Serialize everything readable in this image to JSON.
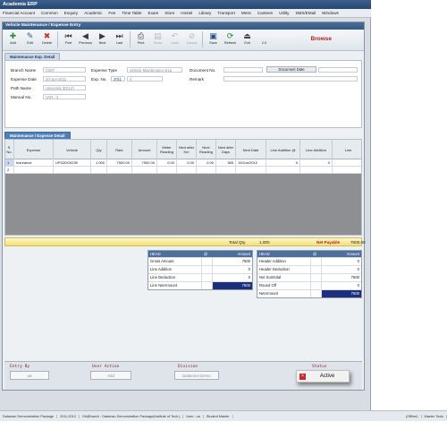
{
  "app": {
    "title": "Academia ERP"
  },
  "menu": [
    "Financial Account",
    "Common",
    "Enquiry",
    "Academic",
    "Fee",
    "Time Table",
    "Exam",
    "Store",
    "Hostel",
    "Library",
    "Transport",
    "Mess",
    "Canteen",
    "Utility",
    "SMS/EMail",
    "Windows"
  ],
  "window": {
    "title": "Vehicle Maintenance / Expense Entry"
  },
  "toolbar": {
    "buttons": [
      {
        "label": "Add",
        "icon": "add-icon"
      },
      {
        "label": "Edit",
        "icon": "edit-icon"
      },
      {
        "label": "Delete",
        "icon": "delete-icon"
      },
      {
        "label": "First",
        "icon": "first-icon"
      },
      {
        "label": "Previous",
        "icon": "previous-icon"
      },
      {
        "label": "Next",
        "icon": "next-icon"
      },
      {
        "label": "Last",
        "icon": "last-icon"
      },
      {
        "label": "Print",
        "icon": "print-icon"
      },
      {
        "label": "Show",
        "icon": "show-icon"
      },
      {
        "label": "Undo",
        "icon": "undo-icon"
      },
      {
        "label": "Cancel",
        "icon": "cancel-icon"
      },
      {
        "label": "Save",
        "icon": "save-icon"
      },
      {
        "label": "Refresh",
        "icon": "refresh-icon"
      },
      {
        "label": "Exit",
        "icon": "exit-icon"
      },
      {
        "label": "2.0",
        "icon": ""
      }
    ],
    "browse": "Browse"
  },
  "form": {
    "tab": "Maintenance Exp. Detail",
    "branch_label": "Branch Name",
    "branch_value": "CMIT",
    "expense_date_label": "Expense Date",
    "expense_date_value": "20-Jun-2011",
    "path_label": "Path Name",
    "path_value": "Universal (EX13)",
    "manual_label": "Manual No.",
    "manual_value": "VAR - 3",
    "expense_type_label": "Expense Type",
    "expense_type_value": "Vehicle Maintenance Exp",
    "exp_no_label": "Exp. No.",
    "exp_no_year": "2011",
    "exp_no_num": "4",
    "doc_no_label": "Document No.",
    "doc_date_label": "Document Date",
    "remark_label": "Remark"
  },
  "grid": {
    "tab": "Maintenance / Expense Detail",
    "headers": [
      "S. No.",
      "Expense",
      "Vehicle",
      "Qty",
      "Rate",
      "Amount",
      "Meter Reading",
      "Next after Km",
      "Next Reading",
      "Next after Days",
      "Next Date",
      "Line Addition @",
      "Line Addition",
      "Line"
    ],
    "rows": [
      [
        "1",
        "Insurance",
        "UP32DG0239",
        "1.000",
        "7500.00",
        "7500.00",
        "0.00",
        "0.00",
        "0.00",
        "365",
        "19/Jun/2012",
        "0",
        "0",
        ""
      ],
      [
        "2",
        "",
        "",
        "",
        "",
        "",
        "",
        "",
        "",
        "",
        "",
        "",
        "",
        ""
      ]
    ]
  },
  "totals": {
    "total_qty_label": "Total Qty.",
    "total_qty_value": "1.000",
    "net_payable_label": "Net Payable",
    "net_payable_value": "7500.00"
  },
  "summary_left": {
    "headers": [
      "HEAD",
      "@",
      "Amount"
    ],
    "rows": [
      {
        "head": "Gross Amount",
        "amount": "7500"
      },
      {
        "head": "Line Addition",
        "amount": "0"
      },
      {
        "head": "Line Deduction",
        "amount": "0"
      },
      {
        "head": "Line NetAmount",
        "amount": "7500"
      }
    ]
  },
  "summary_right": {
    "headers": [
      "HEAD",
      "@",
      "Amount"
    ],
    "rows": [
      {
        "head": "Header Addition",
        "amount": "0"
      },
      {
        "head": "Header Deduction",
        "amount": "0"
      },
      {
        "head": "Net Sumtotal",
        "amount": "7500"
      },
      {
        "head": "Round Off",
        "amount": "0"
      },
      {
        "head": "NetAmount",
        "amount": "7500"
      }
    ]
  },
  "footer": {
    "entry_by_label": "Entry By",
    "entry_by_value": "ua",
    "user_action_label": "User Action",
    "user_action_value": "Add",
    "division_label": "Division",
    "division_value": "Dalamnet Demo",
    "status_label": "Status",
    "status_value": "Active"
  },
  "statusbar": [
    "Dataman Demonstration Package",
    "2011-2012",
    "Ohi(Branch : Dataman Demonstration Package(Institute of Tech.)",
    "User : ua",
    "Student Master",
    "(Offline)",
    "Master Tools"
  ]
}
